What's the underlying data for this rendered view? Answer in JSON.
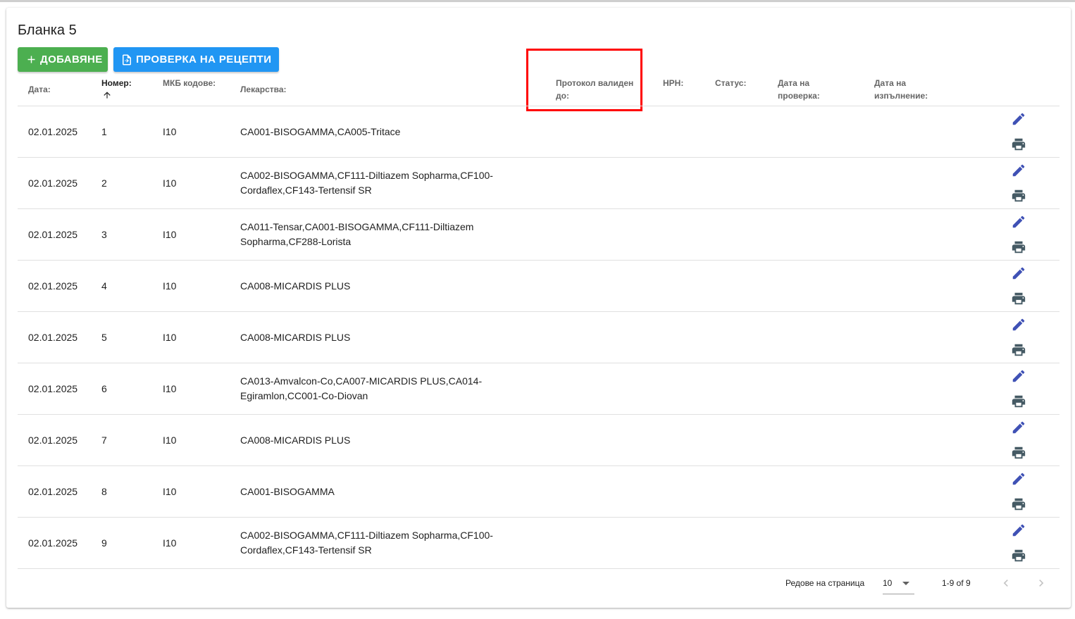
{
  "page": {
    "title": "Бланка 5"
  },
  "toolbar": {
    "add_label": "ДОБАВЯНЕ",
    "check_label": "ПРОВЕРКА НА РЕЦЕПТИ"
  },
  "table": {
    "headers": {
      "date": "Дата:",
      "number": "Номер:",
      "mkb": "МКБ кодове:",
      "meds": "Лекарства:",
      "protocol": "Протокол валиден до:",
      "nrn": "НРН:",
      "status": "Статус:",
      "check_date": "Дата на проверка:",
      "exec_date": "Дата на изпълнение:"
    },
    "sort": {
      "column": "number",
      "direction": "asc"
    },
    "rows": [
      {
        "date": "02.01.2025",
        "number": "1",
        "mkb": "I10",
        "meds": "CA001-BISOGAMMA,CA005-Tritace"
      },
      {
        "date": "02.01.2025",
        "number": "2",
        "mkb": "I10",
        "meds": "CA002-BISOGAMMA,CF111-Diltiazem Sopharma,CF100-Cordaflex,CF143-Tertensif SR"
      },
      {
        "date": "02.01.2025",
        "number": "3",
        "mkb": "I10",
        "meds": "CA011-Tensar,CA001-BISOGAMMA,CF111-Diltiazem Sopharma,CF288-Lorista"
      },
      {
        "date": "02.01.2025",
        "number": "4",
        "mkb": "I10",
        "meds": "CA008-MICARDIS PLUS"
      },
      {
        "date": "02.01.2025",
        "number": "5",
        "mkb": "I10",
        "meds": "CA008-MICARDIS PLUS"
      },
      {
        "date": "02.01.2025",
        "number": "6",
        "mkb": "I10",
        "meds": "CA013-Amvalcon-Co,CA007-MICARDIS PLUS,CA014-Egiramlon,CC001-Co-Diovan"
      },
      {
        "date": "02.01.2025",
        "number": "7",
        "mkb": "I10",
        "meds": "CA008-MICARDIS PLUS"
      },
      {
        "date": "02.01.2025",
        "number": "8",
        "mkb": "I10",
        "meds": "CA001-BISOGAMMA"
      },
      {
        "date": "02.01.2025",
        "number": "9",
        "mkb": "I10",
        "meds": "CA002-BISOGAMMA,CF111-Diltiazem Sopharma,CF100-Cordaflex,CF143-Tertensif SR"
      }
    ]
  },
  "pagination": {
    "rows_per_page_label": "Редове на страница",
    "rows_per_page": "10",
    "range": "1-9 of 9"
  },
  "colors": {
    "add_button": "#4caf50",
    "check_button": "#2196f3",
    "edit_icon": "#3f51b5",
    "print_icon": "#455a64",
    "highlight_box": "#ff0000"
  },
  "icons": {
    "add": "plus-icon",
    "check": "file-document-icon",
    "edit": "pencil-icon",
    "print": "printer-icon",
    "sort": "arrow-up-icon",
    "dropdown": "caret-down-icon",
    "prev": "chevron-left-icon",
    "next": "chevron-right-icon"
  }
}
